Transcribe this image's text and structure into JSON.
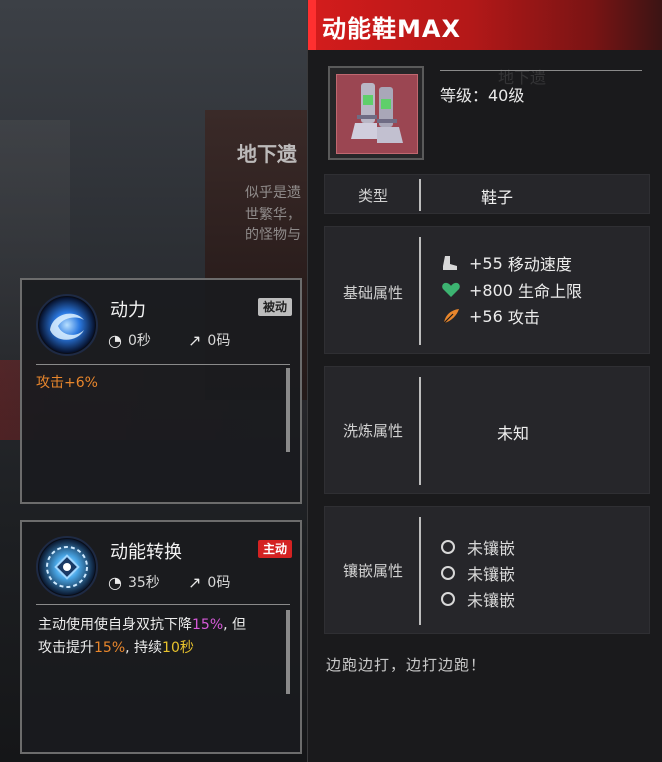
{
  "background": {
    "panel_title": "地下遗",
    "panel_lines": [
      "似乎是遗",
      "世繁华，",
      "的怪物与"
    ]
  },
  "skills": [
    {
      "name": "动力",
      "tag": "被动",
      "tag_color": "#bdbdbd",
      "cooldown": "0秒",
      "range": "0码",
      "icon": "swirl-ring-icon",
      "desc_parts": [
        {
          "text": "攻击+6%",
          "color": "#e8862c"
        }
      ]
    },
    {
      "name": "动能转换",
      "tag": "主动",
      "tag_color": "#d42222",
      "cooldown": "35秒",
      "range": "0码",
      "icon": "energy-core-icon",
      "desc_parts": [
        {
          "text": "主动使用使自身双抗下降",
          "color": "#ececec"
        },
        {
          "text": "15%",
          "color": "#d65ad8"
        },
        {
          "text": ", 但",
          "color": "#ececec"
        },
        {
          "text": "攻击提升",
          "color": "#ececec"
        },
        {
          "text": "15%",
          "color": "#e8862c"
        },
        {
          "text": ", 持续",
          "color": "#ececec"
        },
        {
          "text": "10秒",
          "color": "#e8c22c"
        }
      ]
    }
  ],
  "item": {
    "title": "动能鞋MAX",
    "level": "等级：40级",
    "icon": "armored-boots-icon",
    "type_label": "类型",
    "type_value": "鞋子",
    "base_label": "基础属性",
    "base_stats": [
      {
        "icon": "boot-speed-icon",
        "value": "+55",
        "name": "移动速度",
        "color": "#d8d8d8"
      },
      {
        "icon": "heart-icon",
        "value": "+800",
        "name": "生命上限",
        "color": "#3cb371"
      },
      {
        "icon": "feather-attack-icon",
        "value": "+56",
        "name": "攻击",
        "color": "#e8862c"
      }
    ],
    "refine_label": "洗炼属性",
    "refine_value": "未知",
    "socket_label": "镶嵌属性",
    "sockets": [
      "未镶嵌",
      "未镶嵌",
      "未镶嵌"
    ],
    "flavor": "边跑边打，边打边跑！"
  }
}
